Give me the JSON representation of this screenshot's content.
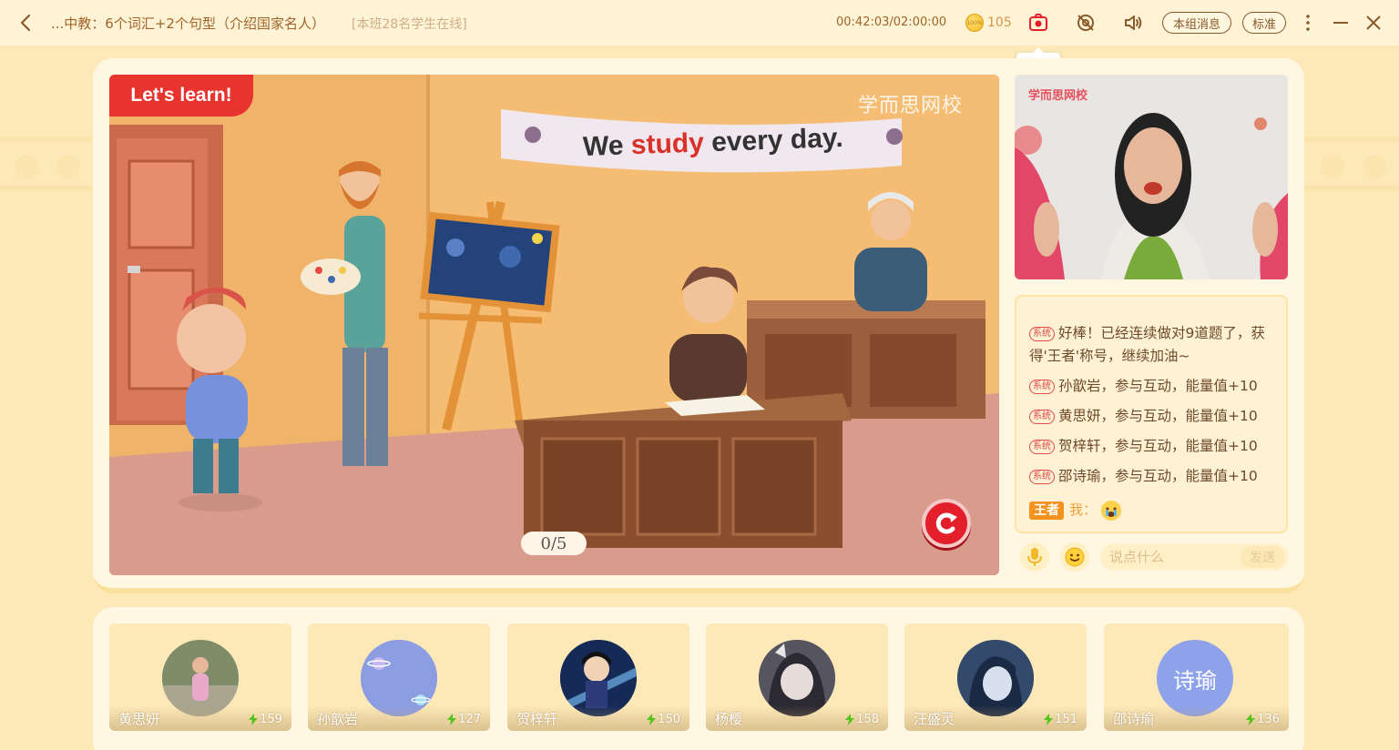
{
  "topbar": {
    "title": "...中教：6个词汇+2个句型（介绍国家名人）",
    "online_status": "[本班28名学生在线]",
    "timer": "00:42:03/02:00:00",
    "coins": "105",
    "coin_icon_text": "100%",
    "group_msg_label": "本组消息",
    "quality_label": "标准",
    "screenshot_tooltip": "截屏"
  },
  "lesson": {
    "tag": "Let's learn!",
    "watermark": "学而思网校",
    "sentence_pre": "We ",
    "sentence_highlight": "study",
    "sentence_post": " every day.",
    "progress": "0/5"
  },
  "teacher_video": {
    "watermark": "学而思网校"
  },
  "chat": {
    "messages": [
      {
        "tag": "系统",
        "text": "好棒！已经连续做对9道题了，获得'王者'称号，继续加油~"
      },
      {
        "tag": "系统",
        "text": "孙歆岩，参与互动，能量值+10"
      },
      {
        "tag": "系统",
        "text": "黄思妍，参与互动，能量值+10"
      },
      {
        "tag": "系统",
        "text": "贺梓轩，参与互动，能量值+10"
      },
      {
        "tag": "系统",
        "text": "邵诗瑜，参与互动，能量值+10"
      }
    ],
    "my_badge": "王者",
    "my_label": "我：",
    "input_placeholder": "说点什么",
    "send_label": "发送"
  },
  "students": [
    {
      "name": "黄思妍",
      "energy": "159"
    },
    {
      "name": "孙歆岩",
      "energy": "127"
    },
    {
      "name": "贺梓轩",
      "energy": "150"
    },
    {
      "name": "杨樱",
      "energy": "158"
    },
    {
      "name": "汪盛灵",
      "energy": "151"
    },
    {
      "name": "邵诗瑜",
      "energy": "136",
      "avatar_text": "诗瑜"
    }
  ],
  "colors": {
    "background": "#fde9b8",
    "panel": "#fff7e2",
    "accent_red": "#e21f2a",
    "title_brown": "#a0642a",
    "energy_green": "#52c41a"
  }
}
